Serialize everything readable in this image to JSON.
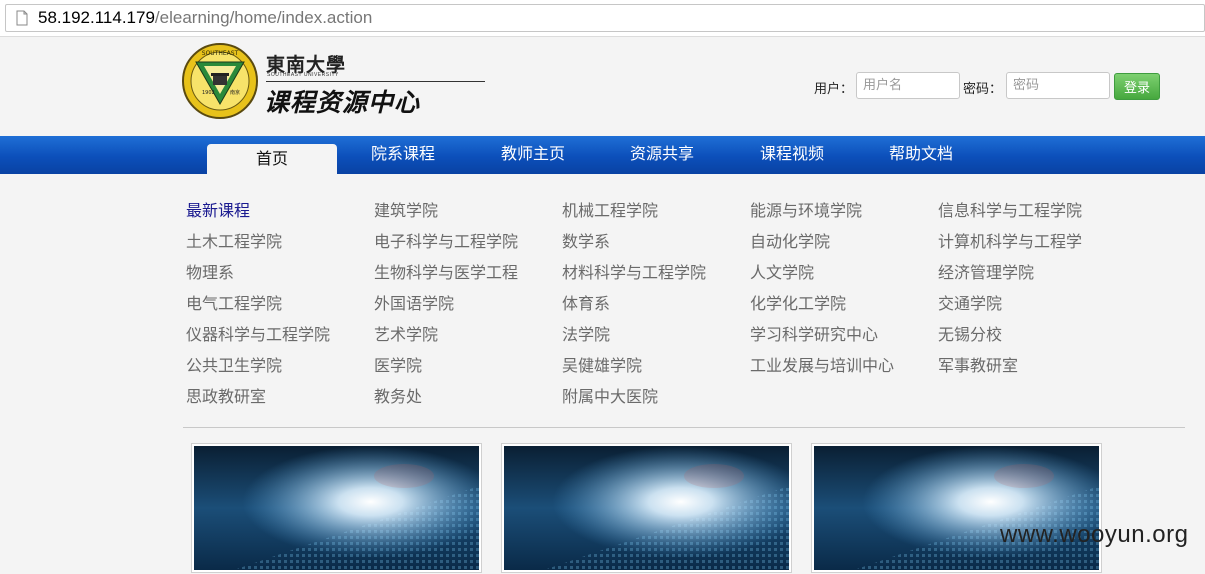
{
  "browser": {
    "url_host": "58.192.114.179",
    "url_path": "/elearning/home/index.action"
  },
  "header": {
    "logo_cn_small": "東南大學",
    "logo_en_small": "SOUTHEAST UNIVERSITY",
    "title": "课程资源中心"
  },
  "login": {
    "username_label": "用户：",
    "username_placeholder": "用户名",
    "password_label": "密码：",
    "password_placeholder": "密码",
    "submit_label": "登录"
  },
  "nav": {
    "items": [
      "首页",
      "院系课程",
      "教师主页",
      "资源共享",
      "课程视频",
      "帮助文档"
    ],
    "active_index": 0
  },
  "departments": [
    [
      "最新课程",
      "建筑学院",
      "机械工程学院",
      "能源与环境学院",
      "信息科学与工程学院"
    ],
    [
      "土木工程学院",
      "电子科学与工程学院",
      "数学系",
      "自动化学院",
      "计算机科学与工程学"
    ],
    [
      "物理系",
      "生物科学与医学工程",
      "材料科学与工程学院",
      "人文学院",
      "经济管理学院"
    ],
    [
      "电气工程学院",
      "外国语学院",
      "体育系",
      "化学化工学院",
      "交通学院"
    ],
    [
      "仪器科学与工程学院",
      "艺术学院",
      "法学院",
      "学习科学研究中心",
      "无锡分校"
    ],
    [
      "公共卫生学院",
      "医学院",
      "吴健雄学院",
      "工业发展与培训中心",
      "军事教研室"
    ],
    [
      "思政教研室",
      "教务处",
      "附属中大医院"
    ]
  ],
  "thumbnails_count": 3,
  "watermark": "www.wooyun.org",
  "colors": {
    "nav_blue": "#0c4fba",
    "login_green": "#46a83e",
    "featured_link": "#1a1a90",
    "link_gray": "#6a6a6a"
  }
}
